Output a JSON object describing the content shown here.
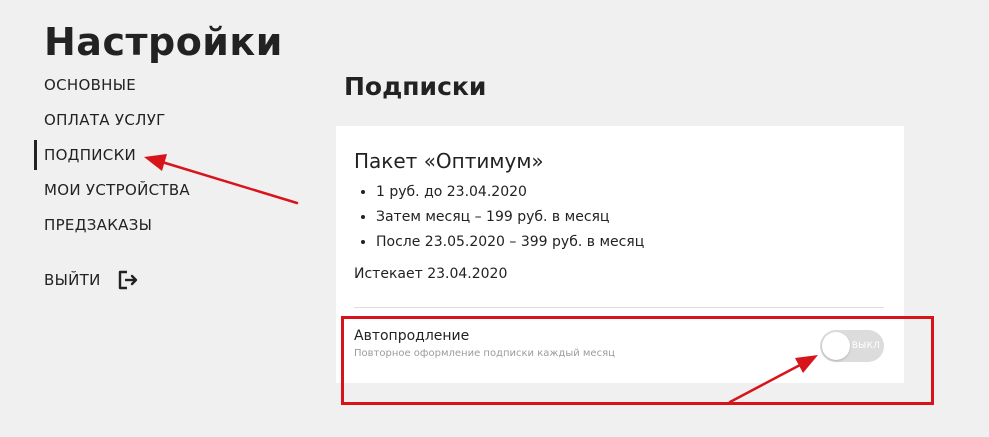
{
  "header": {
    "title": "Настройки"
  },
  "sidebar": {
    "items": [
      {
        "label": "ОСНОВНЫЕ",
        "active": false
      },
      {
        "label": "ОПЛАТА УСЛУГ",
        "active": false
      },
      {
        "label": "ПОДПИСКИ",
        "active": true
      },
      {
        "label": "МОИ УСТРОЙСТВА",
        "active": false
      },
      {
        "label": "ПРЕДЗАКАЗЫ",
        "active": false
      }
    ],
    "logout": {
      "label": "ВЫЙТИ",
      "icon": "logout-icon"
    }
  },
  "main": {
    "section_title": "Подписки",
    "subscription": {
      "title": "Пакет «Оптимум»",
      "features": [
        "1 руб. до 23.04.2020",
        "Затем месяц – 199 руб. в месяц",
        "После 23.05.2020 – 399 руб. в месяц"
      ],
      "expires": "Истекает 23.04.2020",
      "autorenew": {
        "title": "Автопродление",
        "subtitle": "Повторное оформление подписки каждый месяц",
        "toggle_label": "ВЫКЛ",
        "enabled": false
      }
    }
  },
  "colors": {
    "background": "#f0f0f0",
    "card": "#ffffff",
    "text": "#222222",
    "muted": "#9b9b9b",
    "toggle_off": "#dcdcdc",
    "annotation": "#d8141b"
  }
}
